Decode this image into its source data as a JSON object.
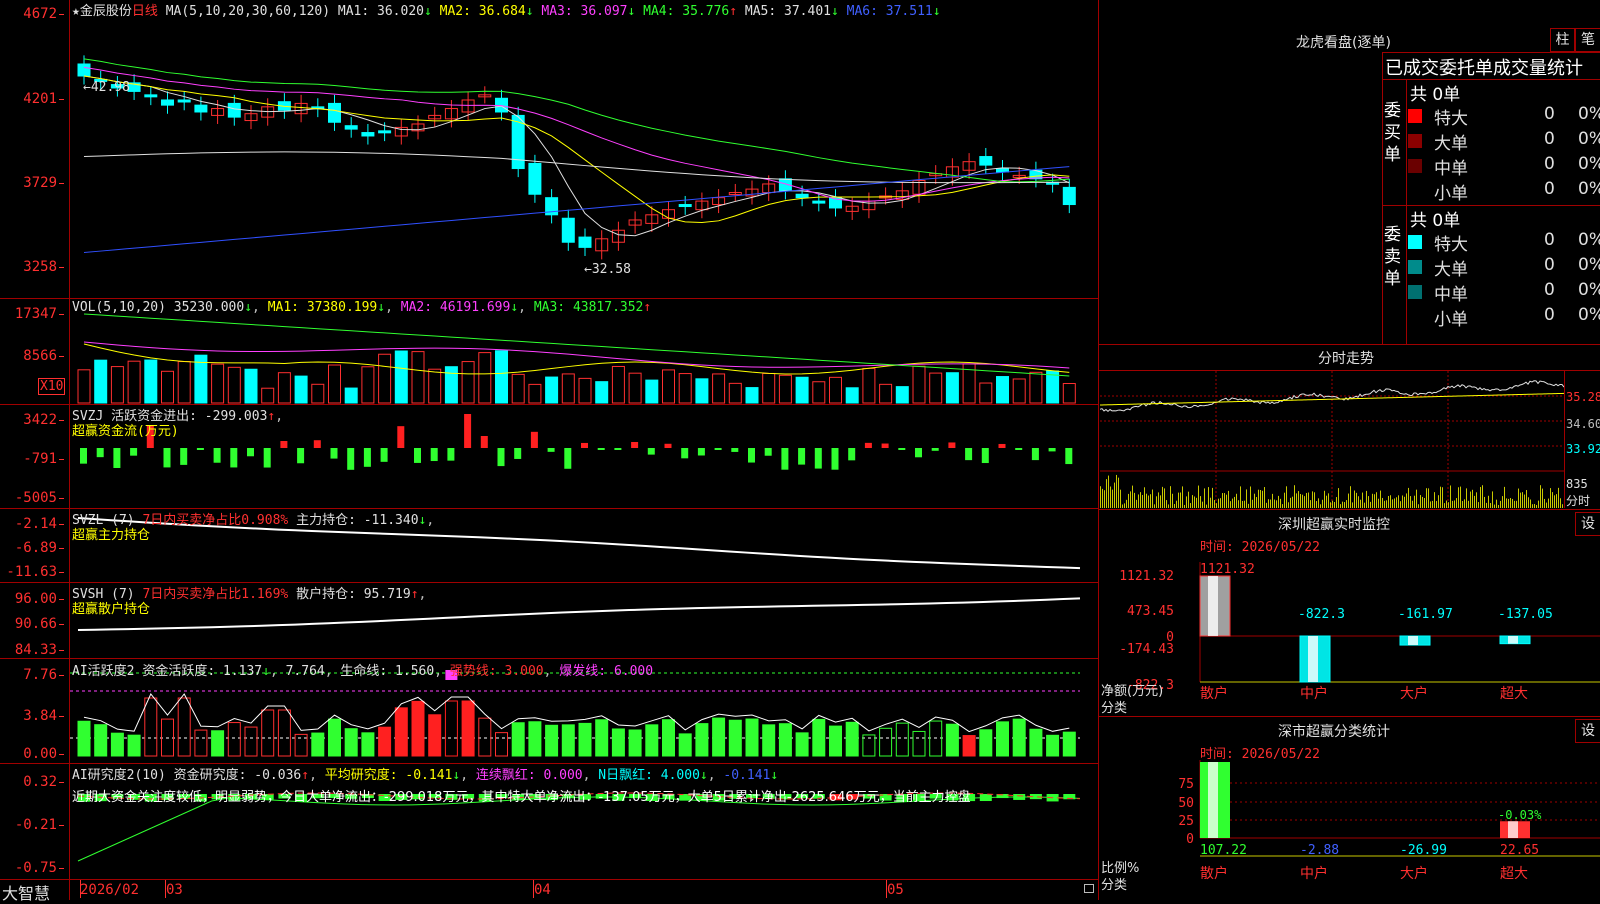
{
  "header": {
    "star": "★",
    "stock_name": "金辰股份",
    "period": "日线",
    "ma_def": "MA(5,10,20,30,60,120)",
    "ma": [
      {
        "label": "MA1:",
        "value": "36.020",
        "arrow": "↓",
        "color": "#e0e0e0"
      },
      {
        "label": "MA2:",
        "value": "36.684",
        "arrow": "↓",
        "color": "#ffff00"
      },
      {
        "label": "MA3:",
        "value": "36.097",
        "arrow": "↓",
        "color": "#ff40ff"
      },
      {
        "label": "MA4:",
        "value": "35.776",
        "arrow": "↑",
        "color": "#30ff30"
      },
      {
        "label": "MA5:",
        "value": "37.401",
        "arrow": "↓",
        "color": "#e0e0e0"
      },
      {
        "label": "MA6:",
        "value": "37.511",
        "arrow": "↓",
        "color": "#4060ff"
      }
    ]
  },
  "price_axis": [
    "4672",
    "4201",
    "3729",
    "3258"
  ],
  "price_marks": {
    "high": "42.98",
    "low": "32.58"
  },
  "vol": {
    "def": "VOL(5,10,20)",
    "value": "35230.000",
    "arrow": "↓",
    "ma1": "MA1: 37380.199",
    "ma1_arrow": "↓",
    "ma2": "MA2: 46191.699",
    "ma2_arrow": "↓",
    "ma3": "MA3: 43817.352",
    "ma3_arrow": "↑",
    "axis": [
      "17347",
      "8566"
    ],
    "unit": "X10"
  },
  "svzj": {
    "name": "SVZJ",
    "label": "活跃资金进出: -299.003",
    "arrow": "↑",
    "sub": "超赢资金流(万元)",
    "axis": [
      "3422",
      "-791",
      "-5005"
    ]
  },
  "svzl": {
    "name": "SVZL (7)",
    "ratio": "7日内买卖净占比0.908%",
    "label": "主力持仓: -11.340",
    "arrow": "↓",
    "sub": "超赢主力持仓",
    "axis": [
      "-2.14",
      "-6.89",
      "-11.63"
    ]
  },
  "svsh": {
    "name": "SVSH (7)",
    "ratio": "7日内买卖净占比1.169%",
    "label": "散户持仓: 95.719",
    "arrow": "↑",
    "sub": "超赢散户持仓",
    "axis": [
      "96.00",
      "90.66",
      "84.33"
    ]
  },
  "ai1": {
    "name": "AI活跃度2",
    "a": "资金活跃度: 1.137",
    "a_arrow": "↓",
    "b": "7.764",
    "c": "生命线: 1.560",
    "d": "强势线: 3.000",
    "e": "爆发线: 6.000",
    "axis": [
      "7.76",
      "3.84",
      "0.00"
    ]
  },
  "ai2": {
    "name": "AI研究度2(10)",
    "a": "资金研究度: -0.036",
    "a_arrow": "↑",
    "b": "平均研究度: -0.141",
    "b_arrow": "↓",
    "c": "连续飘红: 0.000",
    "d": "N日飘红: 4.000",
    "d_arrow": "↓",
    "e": "-0.141",
    "e_arrow": "↓",
    "axis": [
      "0.32",
      "-0.21",
      "-0.75"
    ],
    "comment": "近期大资金关注度较低，明显弱势，今日大单净流出：-299.018万元，其中特大单净流出：-137.05万元，大单5日累计净出-2625.646万元，当前主力控盘"
  },
  "date_axis": {
    "brand": "大智慧",
    "labels": [
      "2026/02",
      "03",
      "04",
      "05"
    ]
  },
  "lhb": {
    "title": "龙虎看盘(逐单)",
    "btn1": "柱",
    "btn2": "笔",
    "subtitle": "已成交委托单成交量统计",
    "buy_label": "委买单",
    "sell_label": "委卖单",
    "buy_total": "共 0单",
    "sell_total": "共 0单",
    "buy_rows": [
      {
        "name": "特大",
        "v": "0",
        "p": "0%",
        "color": "#ff0000"
      },
      {
        "name": "大单",
        "v": "0",
        "p": "0%",
        "color": "#8b0000"
      },
      {
        "name": "中单",
        "v": "0",
        "p": "0%",
        "color": "#6a0000"
      },
      {
        "name": "小单",
        "v": "0",
        "p": "0%",
        "color": ""
      }
    ],
    "sell_rows": [
      {
        "name": "特大",
        "v": "0",
        "p": "0%",
        "color": "#00ffff"
      },
      {
        "name": "大单",
        "v": "0",
        "p": "0%",
        "color": "#008b8b"
      },
      {
        "name": "中单",
        "v": "0",
        "p": "0%",
        "color": "#007070"
      },
      {
        "name": "小单",
        "v": "0",
        "p": "0%",
        "color": ""
      }
    ]
  },
  "intraday": {
    "title": "分时走势",
    "axis": [
      "35.28",
      "34.60",
      "33.92"
    ],
    "vol_axis": [
      "835",
      "分时"
    ]
  },
  "monitor": {
    "title": "深圳超赢实时监控",
    "btn": "设",
    "time": "时间: 2026/05/22",
    "axis": [
      "1121.32",
      "473.45",
      "0",
      "-174.43",
      "-822.3"
    ],
    "footer_top": "净额(万元)",
    "footer_bottom": "分类",
    "cats": [
      "散户",
      "中户",
      "大户",
      "超大"
    ],
    "values": [
      1121.32,
      -822.3,
      -161.97,
      -137.05
    ],
    "labels": [
      "1121.32",
      "-822.3",
      "-161.97",
      "-137.05"
    ]
  },
  "cls": {
    "title": "深市超赢分类统计",
    "btn": "设",
    "time": "时间: 2026/05/22",
    "axis": [
      "75",
      "50",
      "25",
      "0"
    ],
    "footer_top": "比例%",
    "footer_bottom": "分类",
    "cats": [
      "散户",
      "中户",
      "大户",
      "超大"
    ],
    "values": [
      107.22,
      -2.88,
      -26.99,
      22.65
    ],
    "labels": [
      "107.22",
      "-2.88",
      "-26.99",
      "22.65"
    ],
    "extra": "-0.03%"
  }
}
